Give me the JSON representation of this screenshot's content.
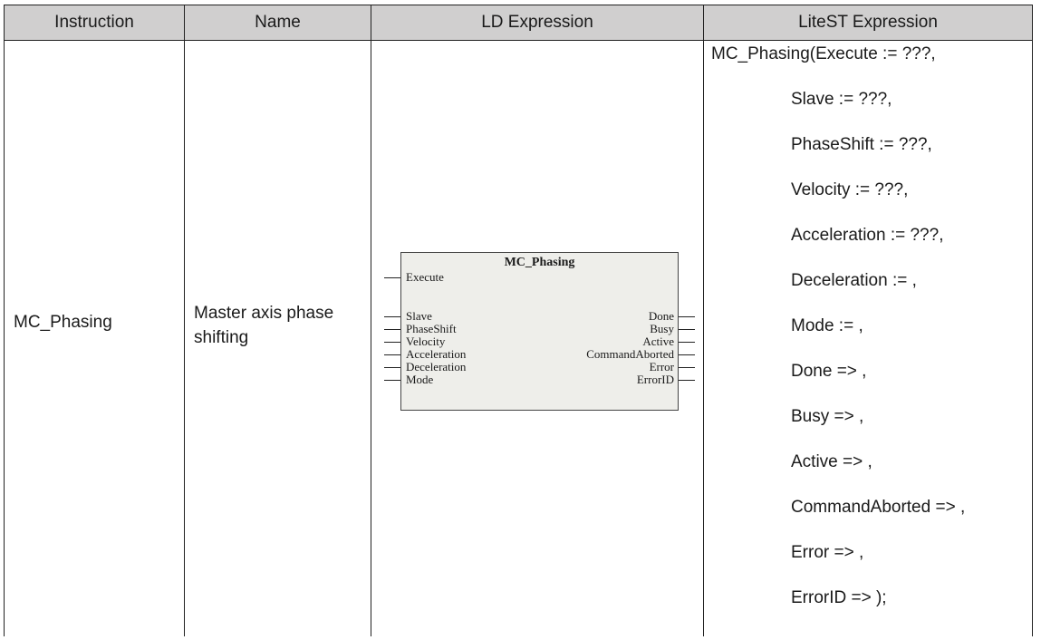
{
  "table": {
    "headers": [
      "Instruction",
      "Name",
      "LD Expression",
      "LiteST Expression"
    ],
    "row": {
      "instruction": "MC_Phasing",
      "name": "Master axis phase shifting"
    }
  },
  "ld_block": {
    "title": "MC_Phasing",
    "inputs": [
      "Execute",
      "Slave",
      "PhaseShift",
      "Velocity",
      "Acceleration",
      "Deceleration",
      "Mode"
    ],
    "outputs": [
      "Done",
      "Busy",
      "Active",
      "CommandAborted",
      "Error",
      "ErrorID"
    ]
  },
  "litest_lines": [
    "MC_Phasing(Execute := ???,",
    "Slave := ???,",
    "PhaseShift := ???,",
    "Velocity := ???,",
    "Acceleration := ???,",
    "Deceleration := ,",
    "Mode := ,",
    "Done => ,",
    "Busy => ,",
    "Active => ,",
    "CommandAborted => ,",
    "Error => ,",
    "ErrorID => );"
  ]
}
